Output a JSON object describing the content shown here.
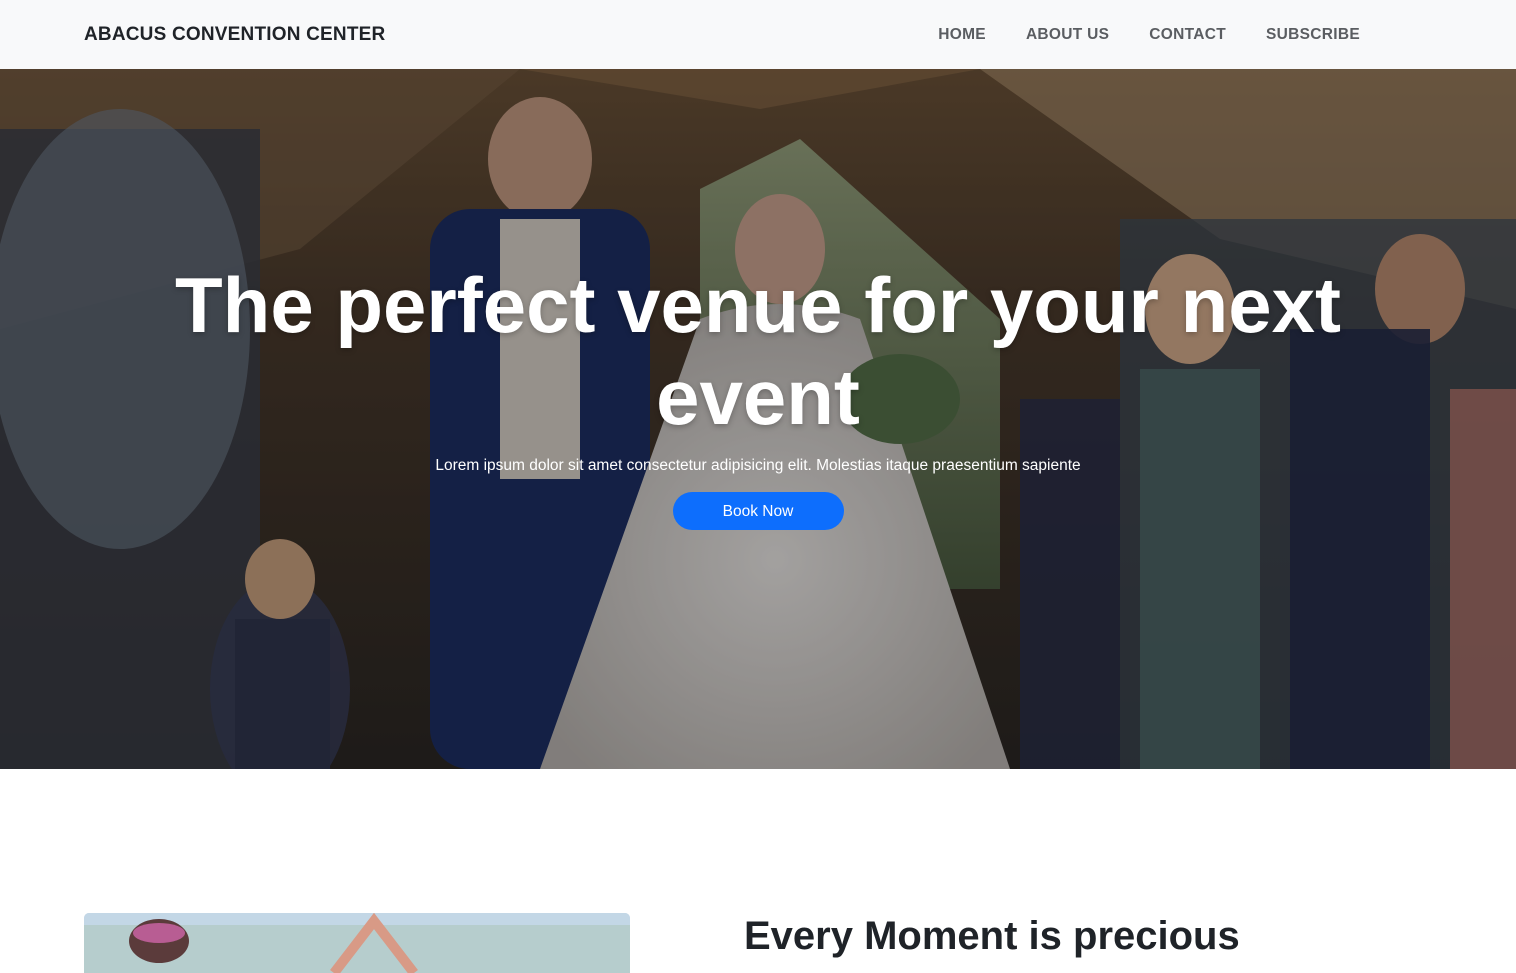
{
  "navbar": {
    "brand": "ABACUS CONVENTION CENTER",
    "links": [
      "HOME",
      "ABOUT US",
      "CONTACT",
      "SUBSCRIBE"
    ]
  },
  "hero": {
    "title": "The perfect venue for your next event",
    "subtitle": "Lorem ipsum dolor sit amet consectetur adipisicing elit. Molestias itaque praesentium sapiente",
    "cta_label": "Book Now",
    "image": "wedding-ceremony-photo"
  },
  "about": {
    "heading": "Every Moment is precious",
    "image": "couple-photo"
  },
  "colors": {
    "navbar_bg": "#f8f9fa",
    "brand_text": "#1f2328",
    "nav_link": "#5a5d61",
    "button_primary": "#0d6efd",
    "hero_text": "#ffffff"
  }
}
